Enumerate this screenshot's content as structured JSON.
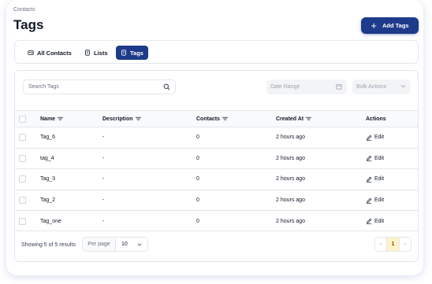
{
  "breadcrumb": "Contacts",
  "page_title": "Tags",
  "add_button": {
    "label": "Add Tags",
    "icon": "plus-icon"
  },
  "tabs": [
    {
      "label": "All Contacts",
      "icon": "contacts-icon",
      "active": false
    },
    {
      "label": "Lists",
      "icon": "list-icon",
      "active": false
    },
    {
      "label": "Tags",
      "icon": "tag-icon",
      "active": true
    }
  ],
  "search": {
    "placeholder": "Search Tags",
    "icon": "search-icon"
  },
  "date_range": {
    "placeholder": "Date Range",
    "icon": "calendar-icon"
  },
  "bulk_actions": {
    "label": "Bulk Actions",
    "icon": "chevron-down-icon"
  },
  "table": {
    "columns": [
      {
        "label": "Name",
        "filter": true
      },
      {
        "label": "Description",
        "filter": true
      },
      {
        "label": "Contacts",
        "filter": true
      },
      {
        "label": "Created At",
        "filter": true
      },
      {
        "label": "Actions",
        "filter": false
      }
    ],
    "rows": [
      {
        "name": "Tag_6",
        "description": "-",
        "contacts": "0",
        "created": "2 hours ago",
        "action": "Edit"
      },
      {
        "name": "tag_4",
        "description": "-",
        "contacts": "0",
        "created": "2 hours ago",
        "action": "Edit"
      },
      {
        "name": "Tag_3",
        "description": "-",
        "contacts": "0",
        "created": "2 hours ago",
        "action": "Edit"
      },
      {
        "name": "Tag_2",
        "description": "-",
        "contacts": "0",
        "created": "2 hours ago",
        "action": "Edit"
      },
      {
        "name": "Tag_one",
        "description": "-",
        "contacts": "0",
        "created": "2 hours ago",
        "action": "Edit"
      }
    ]
  },
  "footer": {
    "showing": "Showing 5 of 5 results",
    "per_page_label": "Per page",
    "per_page_value": "10",
    "pager": {
      "prev": "‹",
      "page": "1",
      "next": "›"
    }
  },
  "colors": {
    "primary": "#1e3a8a",
    "page_highlight": "#fef3c7"
  }
}
